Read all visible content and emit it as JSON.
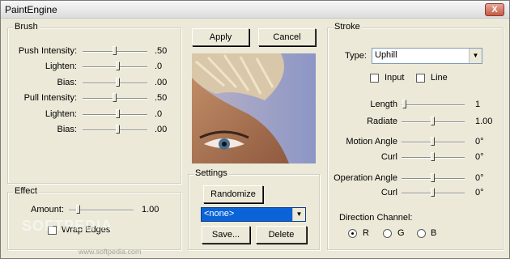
{
  "window": {
    "title": "PaintEngine",
    "close_label": "X"
  },
  "brush": {
    "title": "Brush",
    "sliders": [
      {
        "label": "Push Intensity:",
        "value": ".50",
        "level": 0.5
      },
      {
        "label": "Lighten:",
        "value": ".0",
        "level": 0.55
      },
      {
        "label": "Bias:",
        "value": ".00",
        "level": 0.55
      },
      {
        "label": "Pull Intensity:",
        "value": ".50",
        "level": 0.5
      },
      {
        "label": "Lighten:",
        "value": ".0",
        "level": 0.55
      },
      {
        "label": "Bias:",
        "value": ".00",
        "level": 0.55
      }
    ]
  },
  "effect": {
    "title": "Effect",
    "amount_label": "Amount:",
    "amount_value": "1.00",
    "amount_level": 0.12,
    "wrap_edges_label": "Wrap Edges",
    "wrap_edges_checked": false
  },
  "actions": {
    "apply_label": "Apply",
    "cancel_label": "Cancel"
  },
  "settings": {
    "title": "Settings",
    "randomize_label": "Randomize",
    "preset_value": "<none>",
    "save_label": "Save...",
    "delete_label": "Delete"
  },
  "stroke": {
    "title": "Stroke",
    "type_label": "Type:",
    "type_value": "Uphill",
    "input_label": "Input",
    "input_checked": false,
    "line_label": "Line",
    "line_checked": false,
    "sliders": [
      {
        "label": "Length",
        "value": "1",
        "level": 0.02
      },
      {
        "label": "Radiate",
        "value": "1.00",
        "level": 0.5
      },
      {
        "label": "Motion Angle",
        "value": "0°",
        "level": 0.5
      },
      {
        "label": "Curl",
        "value": "0°",
        "level": 0.5
      },
      {
        "label": "Operation Angle",
        "value": "0°",
        "level": 0.5
      },
      {
        "label": "Curl",
        "value": "0°",
        "level": 0.5
      }
    ],
    "direction_label": "Direction Channel:",
    "channels": [
      {
        "label": "R",
        "selected": true
      },
      {
        "label": "G",
        "selected": false
      },
      {
        "label": "B",
        "selected": false
      }
    ]
  },
  "watermark": {
    "text": "SOFTPEDIA",
    "url": "www.softpedia.com"
  },
  "colors": {
    "face": "#ece9d8",
    "accent": "#0a64d8",
    "close": "#c45a43"
  }
}
